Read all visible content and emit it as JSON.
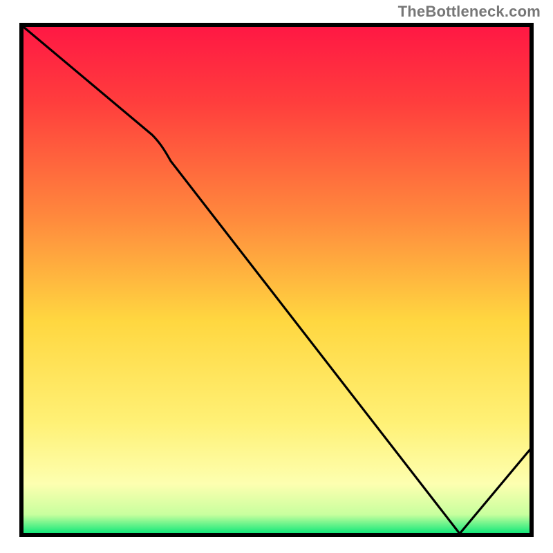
{
  "attribution": "TheBottleneck.com",
  "marker_label": "",
  "colors": {
    "line": "#000000",
    "border": "#000000",
    "gradient_top": "#ff1744",
    "gradient_mid_upper": "#ff7043",
    "gradient_mid": "#ffd740",
    "gradient_mid_lower": "#fff59d",
    "gradient_bottom": "#00e676"
  },
  "chart_data": {
    "type": "line",
    "title": "",
    "xlabel": "",
    "ylabel": "",
    "xlim": [
      0,
      100
    ],
    "ylim": [
      0,
      100
    ],
    "grid": false,
    "legend": false,
    "background": "heatmap-gradient",
    "x": [
      0,
      25,
      85,
      100
    ],
    "values": [
      100,
      79,
      0,
      17
    ],
    "notes": "Values read from curve position relative to plot area; y=0 at bottom (green), y=100 at top (red). Curve descends from top-left, bends around x≈25, reaches minimum near x≈85, then rises toward bottom-right corner."
  }
}
